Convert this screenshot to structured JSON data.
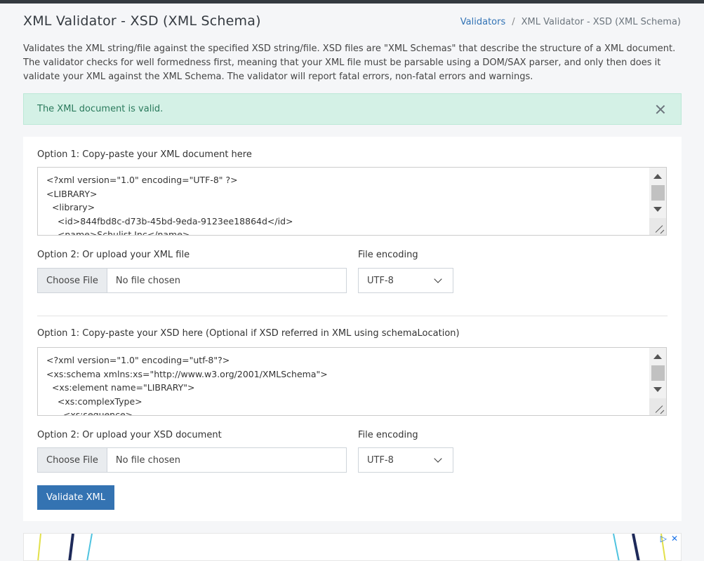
{
  "header": {
    "title": "XML Validator - XSD (XML Schema)",
    "breadcrumb": [
      "Validators",
      "XML Validator - XSD (XML Schema)"
    ]
  },
  "description": "Validates the XML string/file against the specified XSD string/file. XSD files are \"XML Schemas\" that describe the structure of a XML document. The validator checks for well formedness first, meaning that your XML file must be parsable using a DOM/SAX parser, and only then does it validate your XML against the XML Schema. The validator will report fatal errors, non-fatal errors and warnings.",
  "alert": {
    "message": "The XML document is valid.",
    "icon": "close-icon"
  },
  "xml": {
    "paste_label": "Option 1: Copy-paste your XML document here",
    "lines": [
      "<?xml version=\"1.0\" encoding=\"UTF-8\" ?>",
      "<LIBRARY>",
      "  <library>",
      "    <id>844fbd8c-d73b-45bd-9eda-9123ee18864d</id>",
      "    <name>Schulist Inc</name>"
    ],
    "upload_label": "Option 2: Or upload your XML file",
    "file_button": "Choose File",
    "file_status": "No file chosen",
    "encoding_label": "File encoding",
    "encoding_value": "UTF-8"
  },
  "xsd": {
    "paste_label": "Option 1: Copy-paste your XSD here (Optional if XSD referred in XML using schemaLocation)",
    "lines": [
      "<?xml version=\"1.0\" encoding=\"utf-8\"?>",
      "<xs:schema xmlns:xs=\"http://www.w3.org/2001/XMLSchema\">",
      "  <xs:element name=\"LIBRARY\">",
      "    <xs:complexType>",
      "      <xs:sequence>"
    ],
    "upload_label": "Option 2: Or upload your XSD document",
    "file_button": "Choose File",
    "file_status": "No file chosen",
    "encoding_label": "File encoding",
    "encoding_value": "UTF-8"
  },
  "validate_button": "Validate XML",
  "colors": {
    "primary": "#3473b2",
    "success_bg": "#d4f1e6",
    "success_text": "#2a7a5c"
  }
}
